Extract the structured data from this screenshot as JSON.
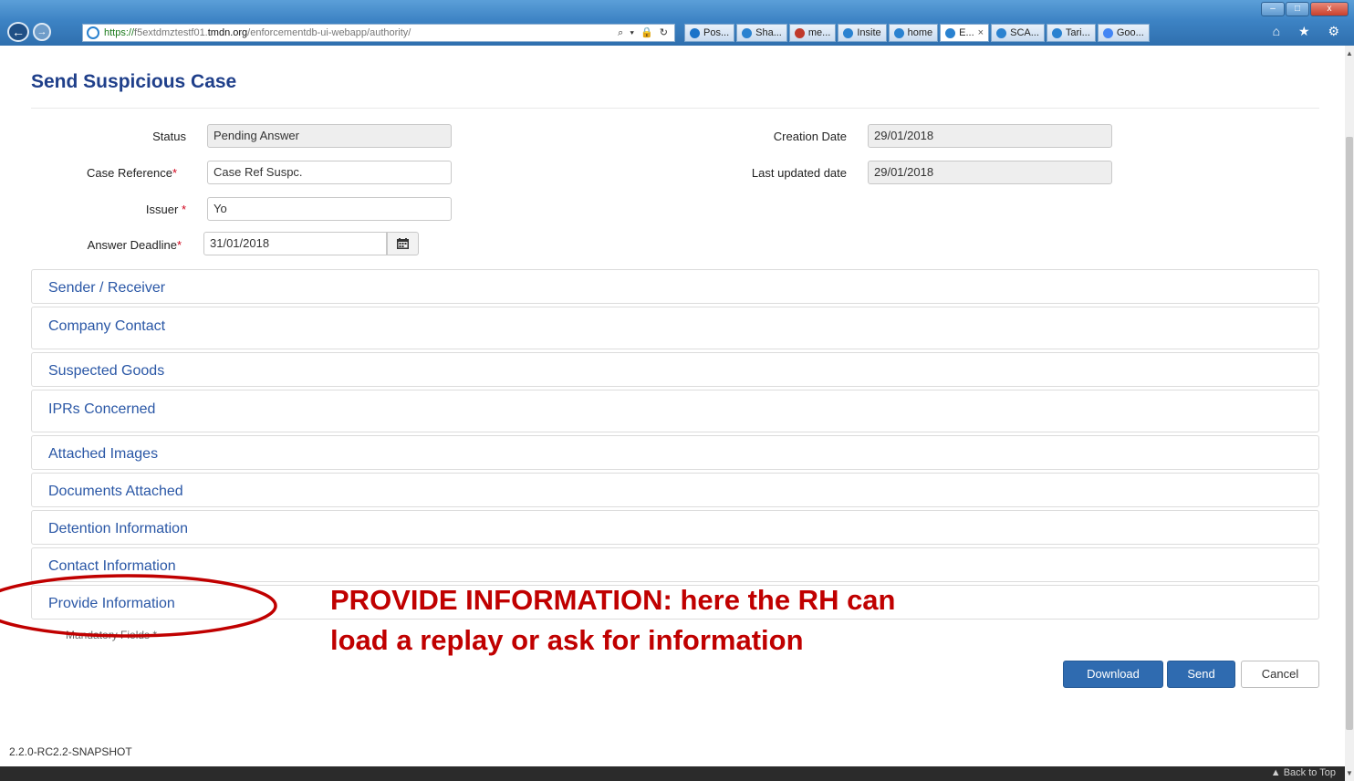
{
  "browser": {
    "url_scheme": "https://",
    "url_sub": "f5extdmztestf01.",
    "url_host": "tmdn.org",
    "url_path": "/enforcementdb-ui-webapp/authority/",
    "address_tools": "⌕ ▾ 🔒 ↻",
    "tabs": [
      {
        "label": "Pos...",
        "color": "#1a73c9",
        "active": false
      },
      {
        "label": "Sha...",
        "color": "#2a82d0",
        "active": false
      },
      {
        "label": "me...",
        "color": "#c0392b",
        "active": false
      },
      {
        "label": "Insite",
        "color": "#2a82d0",
        "active": false
      },
      {
        "label": "home",
        "color": "#2a82d0",
        "active": false
      },
      {
        "label": "E...",
        "color": "#2a82d0",
        "active": true
      },
      {
        "label": "SCA...",
        "color": "#2a82d0",
        "active": false
      },
      {
        "label": "Tari...",
        "color": "#2a82d0",
        "active": false
      },
      {
        "label": "Goo...",
        "color": "#4285f4",
        "active": false
      }
    ],
    "active_tab_close": "×",
    "right_icons": "⌂ ★ ⚙",
    "win_min": "–",
    "win_max": "□",
    "win_close": "x"
  },
  "page": {
    "title": "Send Suspicious Case"
  },
  "form": {
    "status_label": "Status",
    "status_value": "Pending Answer",
    "case_ref_label": "Case Reference",
    "case_ref_value": "Case Ref Suspc.",
    "issuer_label": "Issuer",
    "issuer_value": "Yo",
    "deadline_label": "Answer Deadline",
    "deadline_value": "31/01/2018",
    "creation_date_label": "Creation Date",
    "creation_date_value": "29/01/2018",
    "last_updated_label": "Last updated date",
    "last_updated_value": "29/01/2018",
    "required_mark": "*"
  },
  "sections": [
    "Sender / Receiver",
    "Company Contact",
    "Suspected Goods",
    "IPRs Concerned",
    "Attached Images",
    "Documents Attached",
    "Detention Information",
    "Contact Information",
    "Provide Information"
  ],
  "mandatory_note": "Mandatory Fields *",
  "annotation": {
    "line1": "PROVIDE INFORMATION: here the RH can",
    "line2": "load a replay or ask for information",
    "color": "#c00000"
  },
  "actions": {
    "download": "Download",
    "send": "Send",
    "cancel": "Cancel"
  },
  "footer": {
    "version": "2.2.0-RC2.2-SNAPSHOT",
    "back_to_top": "Back to Top"
  },
  "colors": {
    "title": "#1f3f8a",
    "section_link": "#2a57a6",
    "primary_button": "#2f6bb0",
    "footer_bar": "#2b2b2b"
  }
}
